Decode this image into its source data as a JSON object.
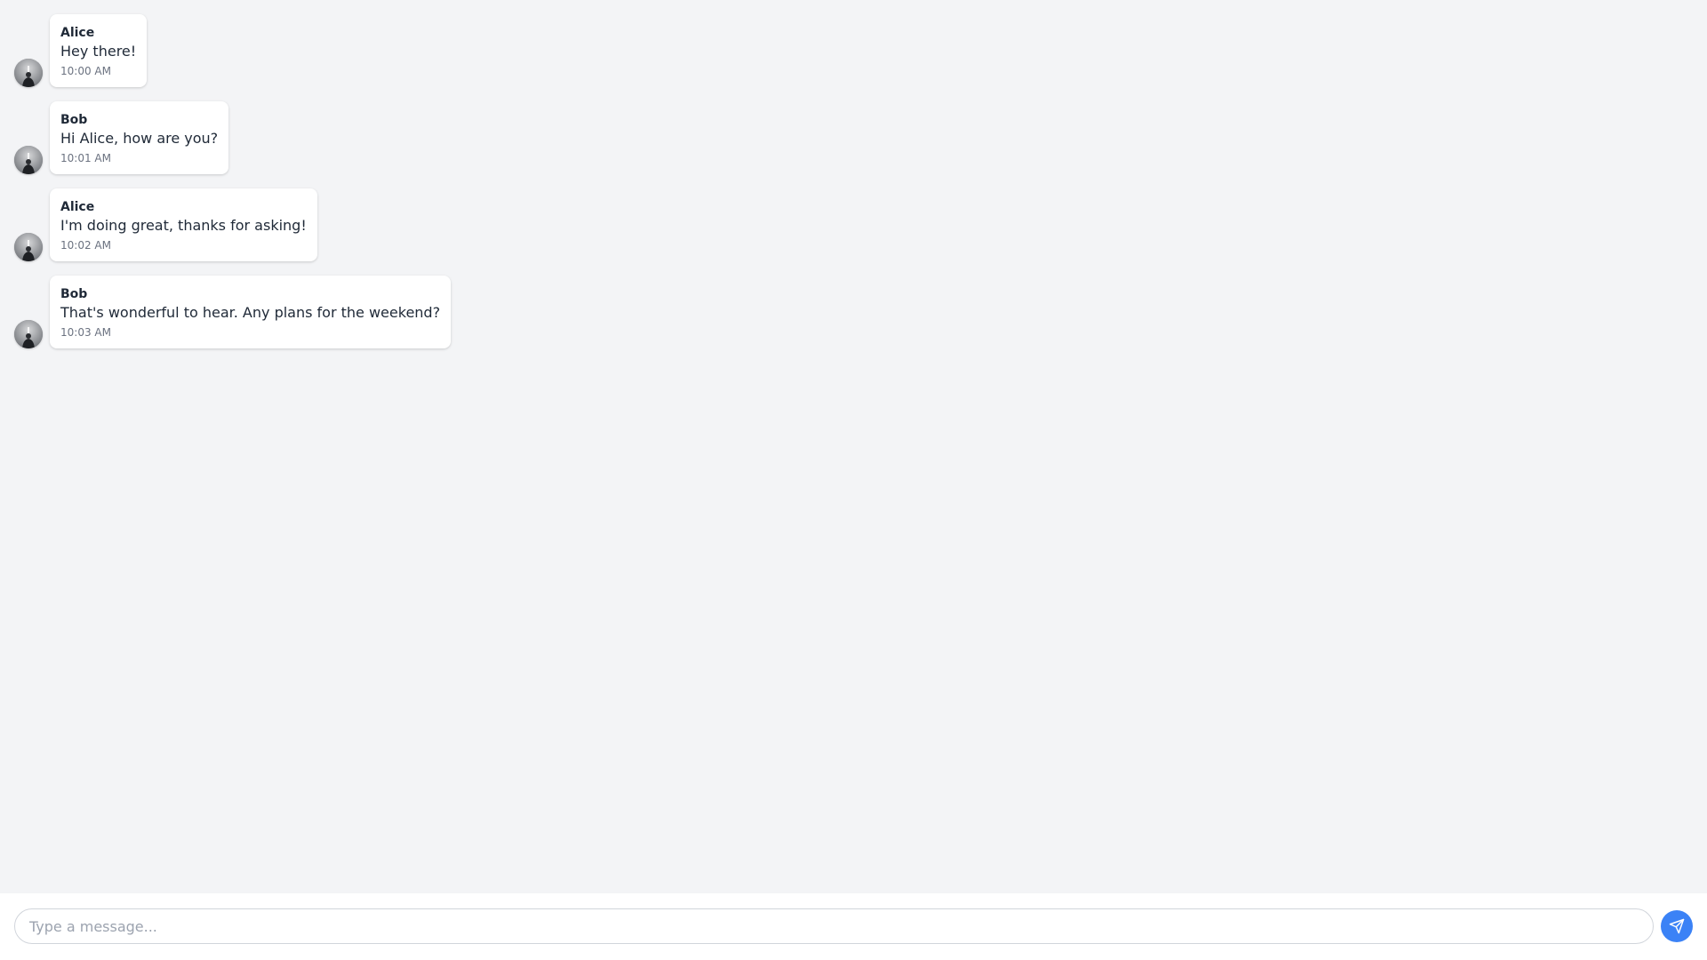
{
  "messages": [
    {
      "sender": "Alice",
      "text": "Hey there!",
      "time": "10:00 AM",
      "avatar_icon": "user-avatar-icon"
    },
    {
      "sender": "Bob",
      "text": "Hi Alice, how are you?",
      "time": "10:01 AM",
      "avatar_icon": "user-avatar-icon"
    },
    {
      "sender": "Alice",
      "text": "I'm doing great, thanks for asking!",
      "time": "10:02 AM",
      "avatar_icon": "user-avatar-icon"
    },
    {
      "sender": "Bob",
      "text": "That's wonderful to hear. Any plans for the weekend?",
      "time": "10:03 AM",
      "avatar_icon": "user-avatar-icon"
    }
  ],
  "composer": {
    "placeholder": "Type a message...",
    "value": "",
    "send_icon": "send-icon"
  },
  "colors": {
    "background": "#f3f4f6",
    "bubble": "#ffffff",
    "accent": "#3b82f6"
  }
}
